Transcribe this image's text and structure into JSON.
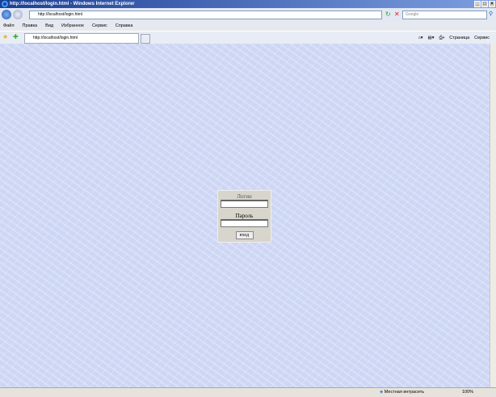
{
  "window": {
    "title": "http://localhost/login.html - Windows Internet Explorer"
  },
  "address": {
    "url": "http://localhost/login.html"
  },
  "search": {
    "placeholder": "Google"
  },
  "menu": [
    "Файл",
    "Правка",
    "Вид",
    "Избранное",
    "Сервис",
    "Справка"
  ],
  "tab": {
    "label": "http://localhost/login.html"
  },
  "toolbar": {
    "page": "Страница",
    "tools": "Сервис"
  },
  "login": {
    "login_label": "Логин",
    "password_label": "Пароль",
    "login_value": "",
    "password_value": "",
    "submit": "вход"
  },
  "status": {
    "zone": "Местная интрасеть",
    "zoom": "100%"
  }
}
